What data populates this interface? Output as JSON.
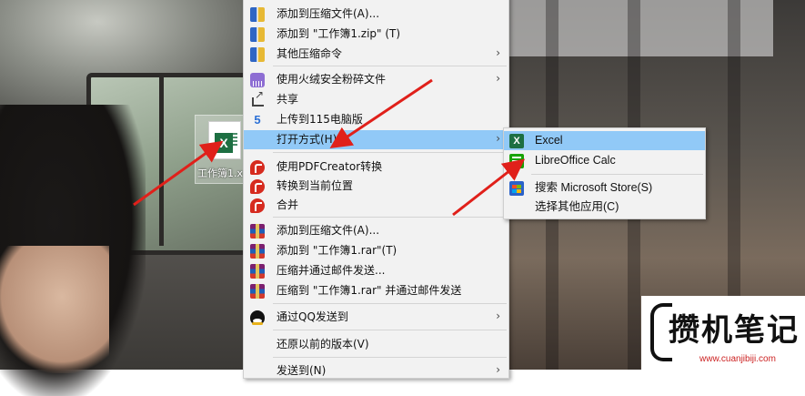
{
  "desktop": {
    "file_label": "工作簿1.x"
  },
  "context_menu": {
    "items": [
      {
        "label": "添加到压缩文件(A)...",
        "icon": "zip-archive-icon"
      },
      {
        "label": "添加到 \"工作簿1.zip\" (T)",
        "icon": "zip-archive-icon"
      },
      {
        "label": "其他压缩命令",
        "icon": "zip-archive-icon",
        "submenu": "›"
      },
      {
        "label": "使用火绒安全粉碎文件",
        "icon": "shredder-icon",
        "submenu": "›"
      },
      {
        "label": "共享",
        "icon": "share-icon"
      },
      {
        "label": "上传到115电脑版",
        "icon": "cloud-115-icon"
      },
      {
        "label": "打开方式(H)",
        "icon": "",
        "submenu": "›",
        "highlighted": true
      },
      {
        "label": "使用PDFCreator转换",
        "icon": "pdfcreator-icon"
      },
      {
        "label": "转换到当前位置",
        "icon": "pdfcreator-icon"
      },
      {
        "label": "合并",
        "icon": "pdfcreator-icon"
      },
      {
        "label": "添加到压缩文件(A)...",
        "icon": "winrar-icon"
      },
      {
        "label": "添加到 \"工作簿1.rar\"(T)",
        "icon": "winrar-icon"
      },
      {
        "label": "压缩并通过邮件发送...",
        "icon": "winrar-icon"
      },
      {
        "label": "压缩到 \"工作簿1.rar\" 并通过邮件发送",
        "icon": "winrar-icon"
      },
      {
        "label": "通过QQ发送到",
        "icon": "qq-icon",
        "submenu": "›"
      },
      {
        "label": "还原以前的版本(V)",
        "icon": ""
      },
      {
        "label": "发送到(N)",
        "icon": "",
        "submenu": "›"
      }
    ]
  },
  "open_with_submenu": {
    "items": [
      {
        "label": "Excel",
        "icon": "excel-icon",
        "highlighted": true
      },
      {
        "label": "LibreOffice Calc",
        "icon": "libreoffice-calc-icon"
      },
      {
        "label": "搜索 Microsoft Store(S)",
        "icon": "microsoft-store-icon"
      },
      {
        "label": "选择其他应用(C)",
        "icon": ""
      }
    ]
  },
  "watermark": {
    "text": "攒机笔记",
    "url": "www.cuanjibiji.com"
  },
  "colors": {
    "highlight": "#91c9f7",
    "menu_bg": "#f2f2f2",
    "arrow": "#e0201a"
  }
}
